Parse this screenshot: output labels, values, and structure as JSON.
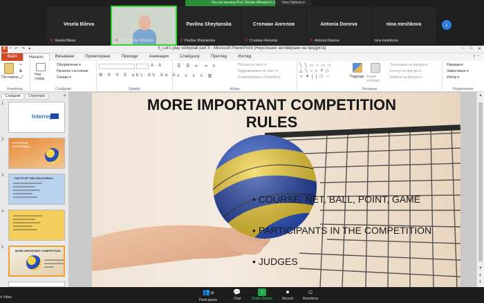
{
  "zoom": {
    "banner": "You are viewing Prof. Dimitar Mihaylov's screen",
    "view_options": "View Options ▾",
    "participants": [
      {
        "name": "Vesela Bileva",
        "label": "Vesela Bileva"
      },
      {
        "name": "",
        "label": "Prof. Dimitar Mihaylov"
      },
      {
        "name": "Pavlina Sheytanska",
        "label": "Pavlina Sheytanska"
      },
      {
        "name": "Стелиан Ангелов",
        "label": "Стелиан Ангелов"
      },
      {
        "name": "Antonia Doneva",
        "label": "Antonia Doneva"
      },
      {
        "name": "nina meshkova",
        "label": "nina meshkova"
      }
    ],
    "toolbar": {
      "start_video": "rt Video",
      "participants_label": "Participants",
      "participants_count": "18",
      "chat": "Chat",
      "share_screen": "Share Screen",
      "record": "Record",
      "reactions": "Reactions"
    }
  },
  "ppt": {
    "window_title": "5_Let's play volleyball part II  -  Microsoft PowerPoint (Неуспешно активиране на продукта)",
    "tabs": [
      "Файл",
      "Начало",
      "Вмъкване",
      "Проектиране",
      "Преходи",
      "Анимации",
      "Слайдшоу",
      "Преглед",
      "Изглед"
    ],
    "ribbon": {
      "paste": "Поставяне",
      "new_slide": "Нов слайд",
      "layout": "Оформление ▾",
      "reset": "Начално състояние",
      "section": "Секция ▾",
      "text_direction": "Посока на текст ▾",
      "align_text": "Подравняване на текст ▾",
      "smartart": "Конвертиране в SmartArt ▾",
      "arrange": "Подреди",
      "quick_styles": "Бързи стилове",
      "shape_fill": "Запълване на фигура ▾",
      "shape_outline": "Контур на фигура ▾",
      "shape_effects": "Ефекти на фигура ▾",
      "find": "Намиране",
      "replace": "Заместване ▾",
      "select": "Избор ▾",
      "groups": [
        "Клипборд",
        "Слайдове",
        "Шрифт",
        "Абзац",
        "Рисуване",
        "Редактиране"
      ]
    },
    "panel_tabs": [
      "Слайдове",
      "Структура"
    ],
    "thumbnails": [
      {
        "num": "1",
        "text": "Interreg"
      },
      {
        "num": "2",
        "text": "LET'S PLAY VOLLEYBALL"
      },
      {
        "num": "3",
        "text": "FACTS OF THE VOLLEYBALL"
      },
      {
        "num": "4",
        "text": ""
      },
      {
        "num": "5",
        "text": "MORE IMPORTANT COMPETITION"
      }
    ],
    "slide": {
      "title_line1": "MORE IMPORTANT COMPETITION",
      "title_line2": "RULES",
      "bullets": [
        "COURSE, NET, BALL, POINT, GAME",
        "PARTICIPANTS  IN THE COMPETITION",
        "JUDGES"
      ]
    }
  },
  "icons": [
    "microphone-muted-icon",
    "next-arrow-icon",
    "participants-icon",
    "chat-icon",
    "share-screen-icon",
    "record-icon",
    "reactions-icon"
  ]
}
